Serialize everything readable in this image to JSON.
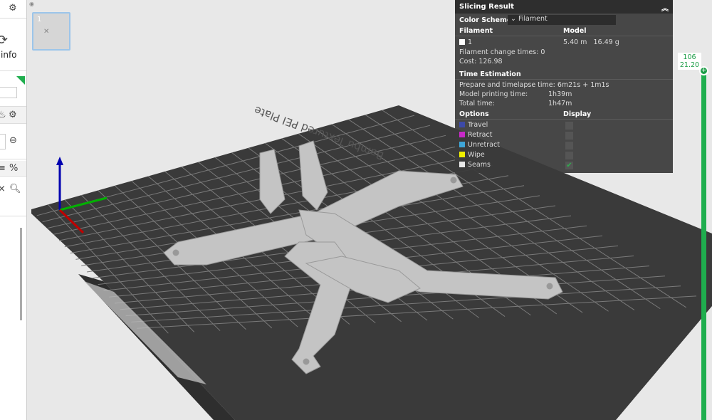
{
  "sidebar": {
    "info_label": "info"
  },
  "plate": {
    "number": "1",
    "bed_label": "Bambu Textured PEI Plate"
  },
  "slicing": {
    "title": "Slicing Result",
    "color_scheme_label": "Color Scheme",
    "color_scheme_value": "Filament",
    "filament_header": "Filament",
    "model_header": "Model",
    "filament_id": "1",
    "length": "5.40 m",
    "weight": "16.49 g",
    "change_times": "Filament change times: 0",
    "cost": "Cost: 126.98",
    "time_header": "Time Estimation",
    "prepare_label": "Prepare and timelapse time:",
    "prepare_value": "6m21s + 1m1s",
    "model_time_label": "Model printing time:",
    "model_time_value": "1h39m",
    "total_label": "Total time:",
    "total_value": "1h47m",
    "options_header": "Options",
    "display_header": "Display",
    "options": [
      {
        "label": "Travel",
        "color": "#3d4aa8",
        "checked": false
      },
      {
        "label": "Retract",
        "color": "#c829c8",
        "checked": false
      },
      {
        "label": "Unretract",
        "color": "#3fa6d8",
        "checked": false
      },
      {
        "label": "Wipe",
        "color": "#f0f000",
        "checked": false
      },
      {
        "label": "Seams",
        "color": "#e8e8e8",
        "checked": true
      }
    ]
  },
  "layer_slider": {
    "layer": "106",
    "height": "21.20"
  }
}
